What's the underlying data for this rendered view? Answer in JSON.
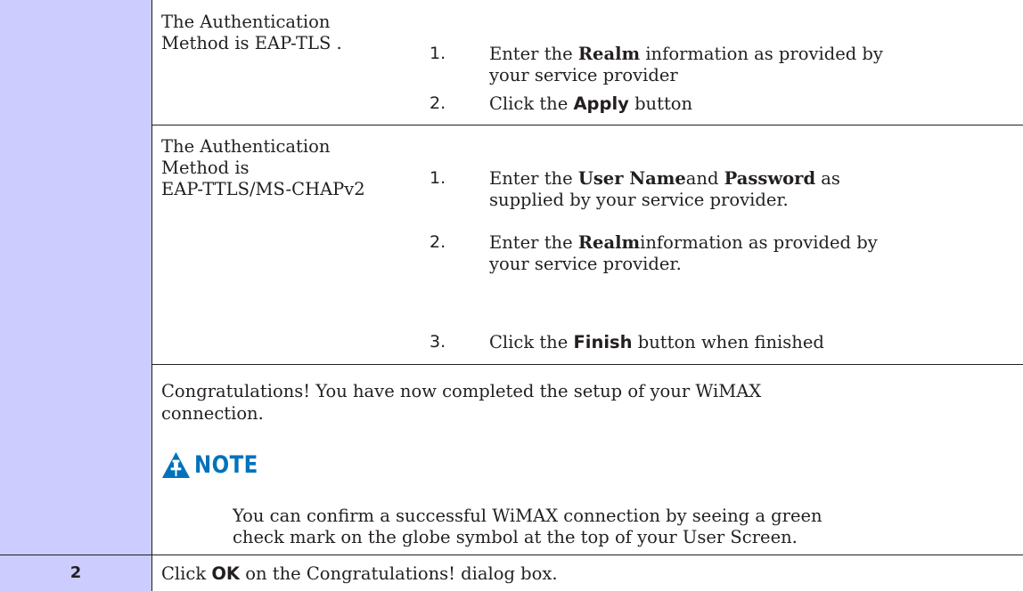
{
  "rows": [
    {
      "condition": "The Authentication\nMethod is EAP-TLS .",
      "substeps": [
        {
          "num": "1.",
          "pre": "Enter the ",
          "b1": "Realm",
          "mid": " information as provided by\nyour service provider",
          "b2": "",
          "post": ""
        },
        {
          "num": "2.",
          "pre": "Click the ",
          "b1": "Apply",
          "mid": " button",
          "b2": "",
          "post": ""
        }
      ]
    },
    {
      "condition": "The Authentication\nMethod  is\nEAP-TTLS/MS-CHAPv2",
      "substeps": [
        {
          "num": "1.",
          "pre": "Enter the ",
          "b1": "User Name",
          "mid": "and ",
          "b2": "Password",
          "post": " as\nsupplied by your service provider."
        },
        {
          "num": "2.",
          "pre": "Enter the ",
          "b1": "Realm",
          "mid": "information as provided by\nyour service provider.",
          "b2": "",
          "post": ""
        },
        {
          "num": "3.",
          "pre": "Click the ",
          "b1": "Finish",
          "mid": " button when finished",
          "b2": "",
          "post": ""
        }
      ]
    }
  ],
  "congratulations": "Congratulations!  You have now completed the setup of your WiMAX\nconnection.",
  "note": {
    "label": "NOTE",
    "icon": "pushpin-warning-icon",
    "text": "You can confirm a successful WiMAX connection by seeing a green\ncheck mark on the globe symbol at the top of your User Screen.",
    "color": "#0072bc"
  },
  "step": {
    "number": "2",
    "pre": "Click ",
    "bold": "OK",
    "post": " on the Congratulations!  dialog box."
  },
  "colors": {
    "step_column": "#ccccff",
    "rule": "#231f20"
  }
}
